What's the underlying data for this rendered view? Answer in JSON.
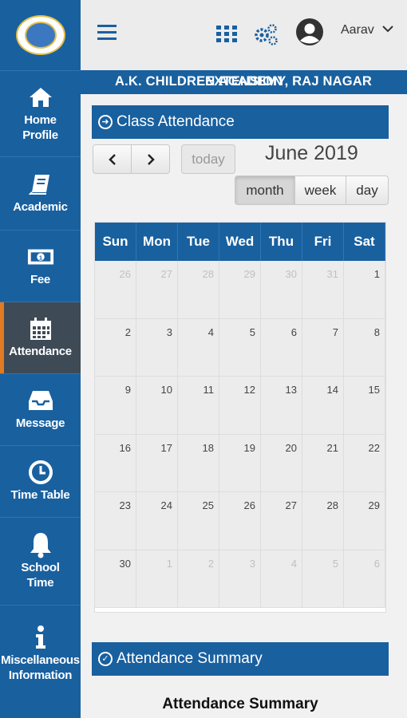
{
  "sidebar": {
    "items": [
      {
        "label_lines": [
          "Home",
          "Profile"
        ],
        "icon": "home-icon"
      },
      {
        "label_lines": [
          "Academic"
        ],
        "icon": "book-icon"
      },
      {
        "label_lines": [
          "Fee"
        ],
        "icon": "money-icon"
      },
      {
        "label_lines": [
          "Attendance"
        ],
        "icon": "calendar-icon",
        "active": true
      },
      {
        "label_lines": [
          "Message"
        ],
        "icon": "inbox-icon"
      },
      {
        "label_lines": [
          "Time Table"
        ],
        "icon": "clock-icon"
      },
      {
        "label_lines": [
          "School",
          "Time"
        ],
        "icon": "bell-icon"
      },
      {
        "label_lines": [
          "Miscellaneous",
          "Information"
        ],
        "icon": "info-icon"
      }
    ]
  },
  "topbar": {
    "username": "Aarav"
  },
  "banner": {
    "text_a": "A.K. CHILDREN ACADEMY, RAJ NAGAR",
    "text_b": "EXTENSION"
  },
  "attendance_panel": {
    "title": "Class Attendance"
  },
  "calendar": {
    "title": "June 2019",
    "today_label": "today",
    "views": [
      "month",
      "week",
      "day"
    ],
    "active_view": "month",
    "weekdays": [
      "Sun",
      "Mon",
      "Tue",
      "Wed",
      "Thu",
      "Fri",
      "Sat"
    ],
    "weeks": [
      [
        {
          "d": "26",
          "o": true
        },
        {
          "d": "27",
          "o": true
        },
        {
          "d": "28",
          "o": true
        },
        {
          "d": "29",
          "o": true
        },
        {
          "d": "30",
          "o": true
        },
        {
          "d": "31",
          "o": true
        },
        {
          "d": "1"
        }
      ],
      [
        {
          "d": "2"
        },
        {
          "d": "3"
        },
        {
          "d": "4"
        },
        {
          "d": "5"
        },
        {
          "d": "6"
        },
        {
          "d": "7"
        },
        {
          "d": "8"
        }
      ],
      [
        {
          "d": "9"
        },
        {
          "d": "10"
        },
        {
          "d": "11"
        },
        {
          "d": "12"
        },
        {
          "d": "13"
        },
        {
          "d": "14"
        },
        {
          "d": "15"
        }
      ],
      [
        {
          "d": "16"
        },
        {
          "d": "17"
        },
        {
          "d": "18"
        },
        {
          "d": "19"
        },
        {
          "d": "20"
        },
        {
          "d": "21"
        },
        {
          "d": "22"
        }
      ],
      [
        {
          "d": "23"
        },
        {
          "d": "24"
        },
        {
          "d": "25"
        },
        {
          "d": "26"
        },
        {
          "d": "27"
        },
        {
          "d": "28"
        },
        {
          "d": "29"
        }
      ],
      [
        {
          "d": "30"
        },
        {
          "d": "1",
          "o": true
        },
        {
          "d": "2",
          "o": true
        },
        {
          "d": "3",
          "o": true
        },
        {
          "d": "4",
          "o": true
        },
        {
          "d": "5",
          "o": true
        },
        {
          "d": "6",
          "o": true
        }
      ]
    ]
  },
  "summary_panel": {
    "title": "Attendance Summary",
    "heading": "Attendance Summary"
  },
  "colors": {
    "primary": "#19609f",
    "active_nav": "#3e4a56",
    "accent": "#e07b22"
  }
}
